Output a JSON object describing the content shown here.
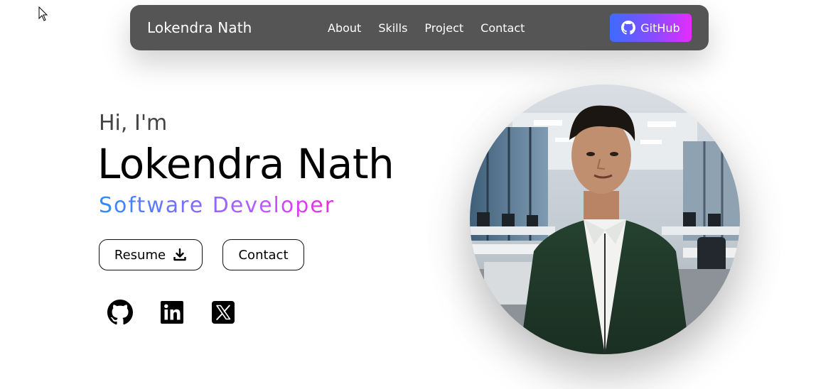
{
  "nav": {
    "brand": "Lokendra Nath",
    "links": [
      "About",
      "Skills",
      "Project",
      "Contact"
    ],
    "github_label": "GitHub"
  },
  "hero": {
    "greeting": "Hi, I'm",
    "name": "Lokendra Nath",
    "role": "Software Developer",
    "resume_label": "Resume",
    "contact_label": "Contact"
  },
  "social": {
    "icons": [
      "github-icon",
      "linkedin-icon",
      "x-icon"
    ]
  },
  "colors": {
    "nav_bg": "#555555",
    "gradient_start": "#3d6bff",
    "gradient_end": "#e62bff"
  }
}
